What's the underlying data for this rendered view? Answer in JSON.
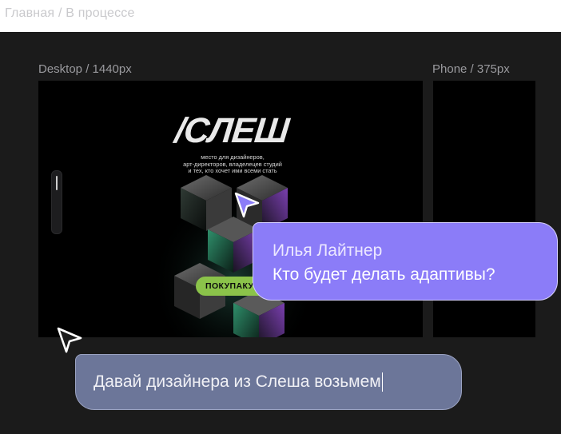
{
  "breadcrumb": "Главная / В процессе",
  "frames": {
    "desktop_label": "Desktop / 1440px",
    "phone_label": "Phone / 375px"
  },
  "preview": {
    "logo": "/СЛЕШ",
    "tagline": [
      "место для дизайнеров,",
      "арт-директоров, владелецев студий",
      "и тех, кто хочет ими всеми стать"
    ],
    "buy_button_label": "ПОКУПАКУ"
  },
  "chat": {
    "author": "Илья Лайтнер",
    "message": "Кто будет делать адаптивы?",
    "draft_message": "Давай дизайнера из Слеша возьмем"
  },
  "colors": {
    "canvas": "#1b1b1b",
    "bubble_purple": "#8b7cf8",
    "bubble_blue": "#6c7699",
    "accent_green": "#8bc34a"
  },
  "icons": [
    "cursor-arrow-icon-purple",
    "cursor-arrow-icon-white"
  ]
}
